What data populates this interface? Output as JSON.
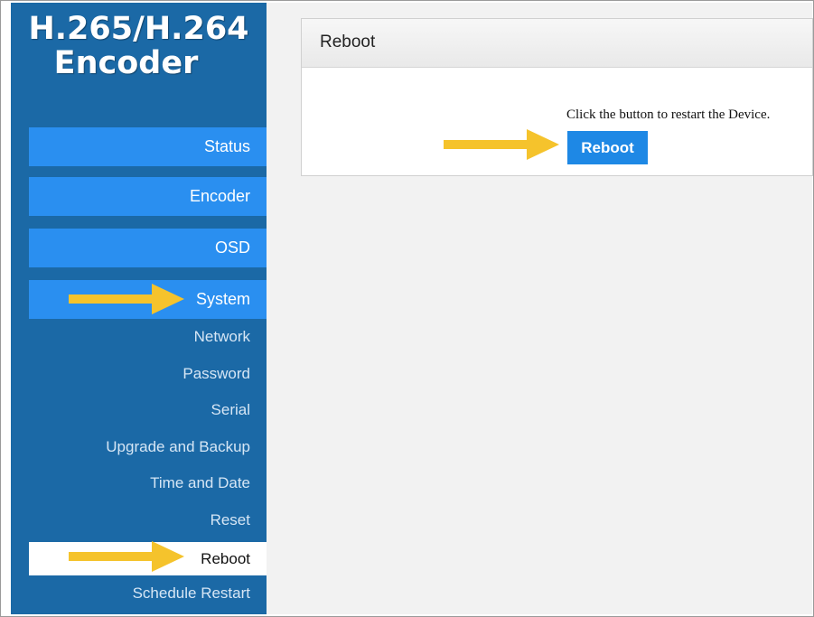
{
  "brand": {
    "line1": "H.265/H.264",
    "line2": "Encoder"
  },
  "nav": {
    "main": [
      {
        "label": "Status"
      },
      {
        "label": "Encoder"
      },
      {
        "label": "OSD"
      },
      {
        "label": "System"
      }
    ],
    "system_sub": [
      {
        "label": "Network"
      },
      {
        "label": "Password"
      },
      {
        "label": "Serial"
      },
      {
        "label": "Upgrade and Backup"
      },
      {
        "label": "Time and Date"
      },
      {
        "label": "Reset"
      },
      {
        "label": "Reboot",
        "active": true
      },
      {
        "label": "Schedule Restart"
      }
    ]
  },
  "panel": {
    "title": "Reboot",
    "description": "Click the button to restart the Device.",
    "button_label": "Reboot"
  },
  "colors": {
    "sidebar": "#1b69a6",
    "nav_button": "#2a8ff0",
    "action_button": "#1e88e5",
    "arrow": "#f5c32c"
  },
  "icons": [
    "arrow-right-icon"
  ]
}
